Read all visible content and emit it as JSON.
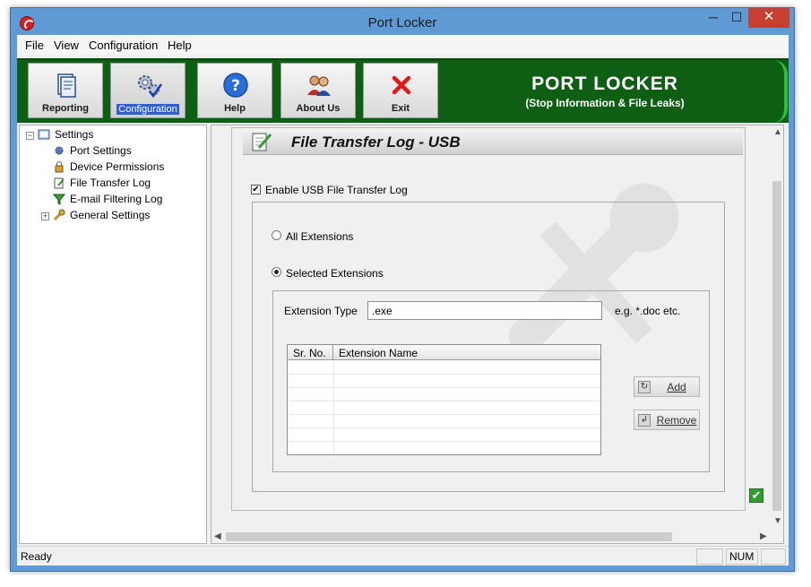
{
  "window": {
    "title": "Port Locker",
    "min_glyph": "─",
    "max_glyph": "☐",
    "close_glyph": "✕"
  },
  "menu": [
    "File",
    "View",
    "Configuration",
    "Help"
  ],
  "toolbar": {
    "buttons": [
      {
        "label": "Reporting",
        "icon": "report-icon"
      },
      {
        "label": "Configuration",
        "icon": "gears-icon",
        "active": true
      },
      {
        "label": "Help",
        "icon": "help-icon"
      },
      {
        "label": "About Us",
        "icon": "users-icon"
      },
      {
        "label": "Exit",
        "icon": "exit-icon"
      }
    ],
    "brand_title": "PORT LOCKER",
    "brand_subtitle": "(Stop Information & File Leaks)"
  },
  "tree": {
    "root": "Settings",
    "items": [
      "Port Settings",
      "Device Permissions",
      "File Transfer Log",
      "E-mail Filtering Log",
      "General Settings"
    ],
    "selected": "File Transfer Log"
  },
  "panel": {
    "title": "File Transfer Log - USB",
    "enable_label": "Enable USB File Transfer Log",
    "enable_checked": true,
    "radio_all": "All Extensions",
    "radio_selected": "Selected Extensions",
    "selected_option": "Selected Extensions",
    "ext_type_label": "Extension Type",
    "ext_type_value": ".exe",
    "ext_hint": "e.g. *.doc etc.",
    "grid_headers": [
      "Sr. No.",
      "Extension Name"
    ],
    "add_label": "Add",
    "remove_label": "Remove"
  },
  "status": {
    "text": "Ready",
    "num": "NUM"
  },
  "colors": {
    "toolbar_green": "#0e5e14",
    "titlebar": "#5f9ad4",
    "close_red": "#c7402f",
    "ok_green": "#2f9e2f"
  }
}
